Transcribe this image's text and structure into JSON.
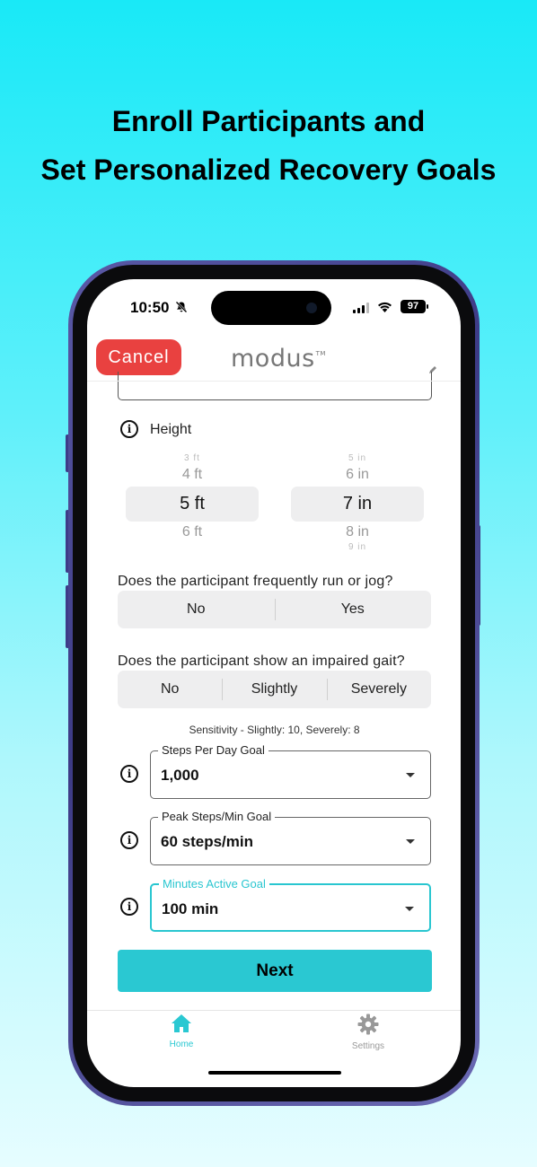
{
  "headline": {
    "line1": "Enroll Participants and",
    "line2": "Set Personalized Recovery Goals"
  },
  "status_bar": {
    "time": "10:50",
    "battery": "97"
  },
  "header": {
    "cancel_label": "Cancel",
    "logo_text": "modus",
    "logo_tm": "TM"
  },
  "height": {
    "label": "Height",
    "feet_options": [
      "3 ft",
      "4 ft",
      "5 ft",
      "6 ft"
    ],
    "feet_selected": "5 ft",
    "inch_options": [
      "5 in",
      "6 in",
      "7 in",
      "8 in",
      "9 in"
    ],
    "inch_selected": "7 in"
  },
  "run_question": {
    "text": "Does the participant frequently run or jog?",
    "options": [
      "No",
      "Yes"
    ]
  },
  "gait_question": {
    "text": "Does the participant show an impaired gait?",
    "options": [
      "No",
      "Slightly",
      "Severely"
    ],
    "sensitivity": "Sensitivity - Slightly: 10, Severely: 8"
  },
  "goals": {
    "steps_per_day": {
      "label": "Steps Per Day Goal",
      "value": "1,000"
    },
    "peak_steps": {
      "label": "Peak Steps/Min Goal",
      "value": "60 steps/min"
    },
    "minutes_active": {
      "label": "Minutes Active Goal",
      "value": "100 min"
    }
  },
  "next_label": "Next",
  "tab_bar": {
    "home": "Home",
    "settings": "Settings"
  },
  "colors": {
    "accent": "#2ac8d2",
    "cancel": "#e94140",
    "tab_inactive": "#999999"
  }
}
